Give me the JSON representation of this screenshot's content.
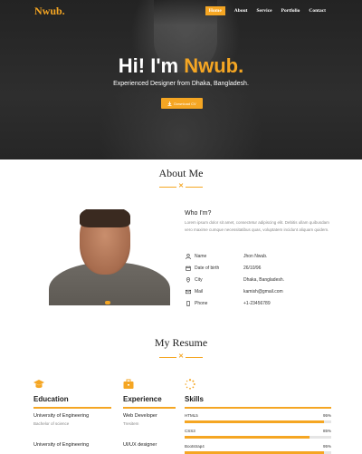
{
  "header": {
    "logo": "Nwub.",
    "nav": [
      "Home",
      "About",
      "Service",
      "Portfolio",
      "Contact"
    ],
    "active_nav": "Home"
  },
  "hero": {
    "title_prefix": "Hi! I'm ",
    "title_accent": "Nwub.",
    "subtitle": "Experienced Designer from Dhaka, Bangladesh.",
    "button_label": "Download CV"
  },
  "about": {
    "title": "About Me",
    "heading": "Who I'm?",
    "text": "Lorem ipsum dolor sit amet, consectetur adipiscing elit. Debitis ullam quibusdam vero maxime cumque necessitatibus quas, voluptatem incidunt aliquam quidem.",
    "info": [
      {
        "icon": "user-icon",
        "label": "Name",
        "value": "Jhon Nwub."
      },
      {
        "icon": "calendar-icon",
        "label": "Date of birth",
        "value": "26/10/96"
      },
      {
        "icon": "location-icon",
        "label": "City",
        "value": "Dhaka, Bangladesh."
      },
      {
        "icon": "mail-icon",
        "label": "Mail",
        "value": "kamish@gmail.com"
      },
      {
        "icon": "phone-icon",
        "label": "Phone",
        "value": "+1-23456789"
      }
    ]
  },
  "resume": {
    "title": "My Resume",
    "education": {
      "title": "Education",
      "items": [
        {
          "title": "University of Engineering",
          "sub": "Bachelor of science"
        },
        {
          "title": "University of Engineering",
          "sub": ""
        }
      ]
    },
    "experience": {
      "title": "Experience",
      "items": [
        {
          "title": "Web Developer",
          "sub": "Tresitem"
        },
        {
          "title": "UI/UX designer",
          "sub": ""
        }
      ]
    },
    "skills": {
      "title": "Skills",
      "items": [
        {
          "name": "HTML5",
          "pct": "95%",
          "value": 95
        },
        {
          "name": "CSS3",
          "pct": "85%",
          "value": 85
        },
        {
          "name": "Bootstrap4",
          "pct": "95%",
          "value": 95
        }
      ]
    }
  },
  "colors": {
    "accent": "#f5a623",
    "dark": "#2a2a2a"
  }
}
